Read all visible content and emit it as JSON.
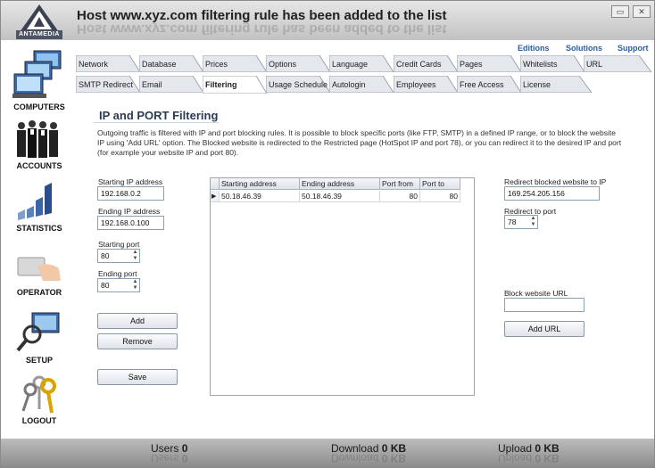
{
  "app": {
    "logo_text": "ANTAMEDIA",
    "title": "Host www.xyz.com filtering rule has been added to the list"
  },
  "window_controls": {
    "minimize": "▭",
    "close": "✕"
  },
  "top_links": [
    "Editions",
    "Solutions",
    "Support"
  ],
  "sidebar": [
    {
      "label": "COMPUTERS",
      "icon": "computers-icon"
    },
    {
      "label": "ACCOUNTS",
      "icon": "accounts-icon"
    },
    {
      "label": "STATISTICS",
      "icon": "statistics-icon"
    },
    {
      "label": "OPERATOR",
      "icon": "operator-icon"
    },
    {
      "label": "SETUP",
      "icon": "setup-icon"
    },
    {
      "label": "LOGOUT",
      "icon": "keys-icon"
    }
  ],
  "tabs_row1": [
    "Network",
    "Database",
    "Prices",
    "Options",
    "Language",
    "Credit Cards",
    "Pages",
    "Whitelists",
    "URL"
  ],
  "tabs_row2": [
    "SMTP Redirect",
    "Email",
    "Filtering",
    "Usage Schedule",
    "Autologin",
    "Employees",
    "Free Access",
    "License"
  ],
  "active_tab": "Filtering",
  "section": {
    "heading": "IP and PORT Filtering",
    "description": "Outgoing traffic is filtered with IP and port blocking rules. It is possible to block specific ports (like FTP, SMTP) in a defined IP range, or to block the website IP using 'Add URL' option. The Blocked website is redirected to the Restricted page (HotSpot IP and port 78), or you can redirect it to the desired IP and port (for example your website IP and port 80)."
  },
  "form": {
    "starting_ip_label": "Starting IP address",
    "starting_ip_value": "192.168.0.2",
    "ending_ip_label": "Ending IP address",
    "ending_ip_value": "192.168.0.100",
    "starting_port_label": "Starting port",
    "starting_port_value": "80",
    "ending_port_label": "Ending port",
    "ending_port_value": "80",
    "add_label": "Add",
    "remove_label": "Remove",
    "save_label": "Save"
  },
  "table": {
    "columns": [
      "Starting address",
      "Ending address",
      "Port from",
      "Port to"
    ],
    "rows": [
      [
        "50.18.46.39",
        "50.18.46.39",
        "80",
        "80"
      ]
    ]
  },
  "redirect": {
    "redirect_ip_label": "Redirect blocked website to IP",
    "redirect_ip_value": "169.254.205.156",
    "redirect_port_label": "Redirect to port",
    "redirect_port_value": "78",
    "block_url_label": "Block website URL",
    "block_url_value": "",
    "add_url_label": "Add URL"
  },
  "status": {
    "users_label": "Users",
    "users_value": "0",
    "download_label": "Download",
    "download_value": "0 KB",
    "upload_label": "Upload",
    "upload_value": "0 KB"
  }
}
